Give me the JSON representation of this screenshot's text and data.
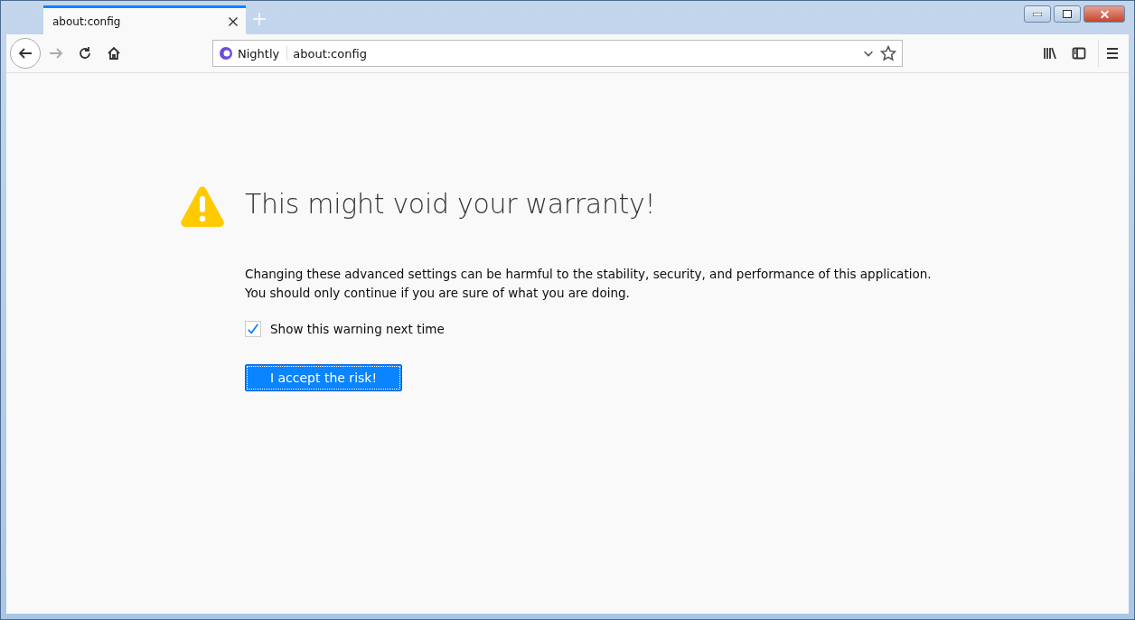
{
  "tabs": [
    {
      "label": "about:config",
      "selected": true
    }
  ],
  "nav": {
    "back_disabled": false,
    "forward_disabled": true
  },
  "urlbar": {
    "identity": "Nightly",
    "value": "about:config"
  },
  "warning": {
    "title": "This might void your warranty!",
    "description": "Changing these advanced settings can be harmful to the stability, security, and performance of this application. You should only continue if you are sure of what you are doing.",
    "checkbox": {
      "label": "Show this warning next time",
      "checked": true
    },
    "button": "I accept the risk!"
  }
}
